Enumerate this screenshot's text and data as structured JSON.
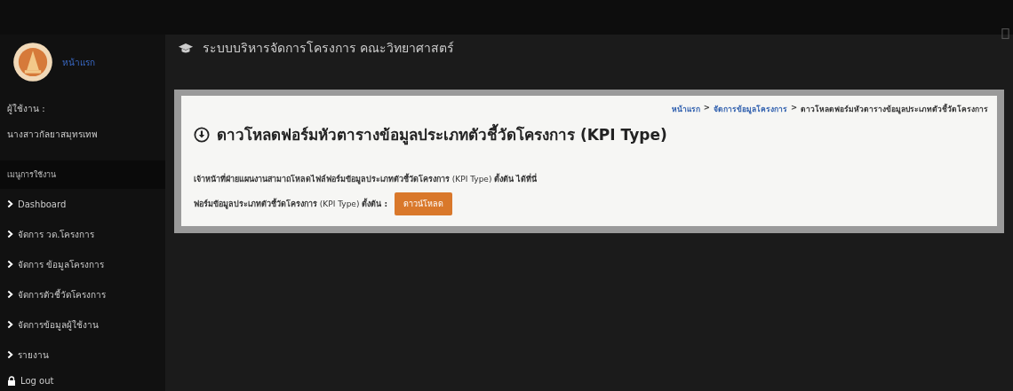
{
  "sidebar": {
    "logo_link": "หน้าแรก",
    "user_label": "ผู้ใช้งาน :",
    "user_name": "นางสาวกัลยาสมุทรเทพ",
    "menu_heading": "เมนูการใช้งาน",
    "items": [
      {
        "label": "Dashboard",
        "kind": "menu"
      },
      {
        "label": "จัดการ วด.โครงการ",
        "kind": "menu"
      },
      {
        "label": "จัดการ ข้อมูลโครงการ",
        "kind": "menu"
      },
      {
        "label": "จัดการตัวชี้วัดโครงการ",
        "kind": "menu"
      },
      {
        "label": "จัดการข้อมูลผู้ใช้งาน",
        "kind": "menu"
      },
      {
        "label": "รายงาน",
        "kind": "menu"
      },
      {
        "label": "Log out",
        "kind": "logout"
      }
    ]
  },
  "header": {
    "title": "ระบบบริหารจัดการโครงการ คณะวิทยาศาสตร์"
  },
  "breadcrumb": [
    {
      "label": "หน้าแรก",
      "kind": "link"
    },
    {
      "label": ">",
      "kind": "separator"
    },
    {
      "label": "จัดการข้อมูลโครงการ",
      "kind": "link"
    },
    {
      "label": ">",
      "kind": "separator"
    },
    {
      "label": "ดาวโหลดฟอร์มหัวตารางข้อมูลประเภทตัวชี้วัดโครงการ",
      "kind": "current"
    }
  ],
  "panel": {
    "title": "ดาวโหลดฟอร์มหัวตารางข้อมูลประเภทตัวชี้วัดโครงการ (KPI Type)",
    "description": "**เจ้าหน้าที่ฝ่ายแผนงานสามาถโหลดไฟล์ฟอร์มข้อมูลประเภทตัวชี้วัดโครงการ** (KPI Type) **ตั้งต้น ได้ที่นี่**",
    "download_label": "**ฟอร์มข้อมูลประเภทตัวชี้วัดโครงการ** (KPI Type) **ตั้งต้น :**",
    "download_button": "ดาวน์โหลด"
  }
}
